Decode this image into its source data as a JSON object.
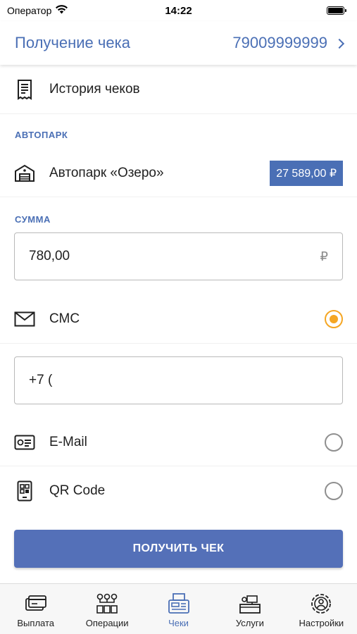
{
  "status_bar": {
    "carrier": "Оператор",
    "time": "14:22"
  },
  "header": {
    "title": "Получение чека",
    "phone": "79009999999"
  },
  "history": {
    "label": "История чеков"
  },
  "fleet_section": {
    "label": "АВТОПАРК",
    "name": "Автопарк «Озеро»",
    "balance": "27 589,00 ₽"
  },
  "amount_section": {
    "label": "СУММА",
    "value": "780,00",
    "currency": "₽"
  },
  "options": {
    "sms": {
      "label": "СМС",
      "phone_value": "+7 ("
    },
    "email": {
      "label": "E-Mail"
    },
    "qr": {
      "label": "QR Code"
    }
  },
  "submit_label": "ПОЛУЧИТЬ ЧЕК",
  "tabs": [
    {
      "label": "Выплата",
      "icon": "payout-icon"
    },
    {
      "label": "Операции",
      "icon": "operations-icon"
    },
    {
      "label": "Чеки",
      "icon": "receipts-icon"
    },
    {
      "label": "Услуги",
      "icon": "services-icon"
    },
    {
      "label": "Настройки",
      "icon": "settings-icon"
    }
  ],
  "colors": {
    "accent": "#4a6fb5",
    "selected_radio": "#f5a623",
    "button": "#5470b8"
  }
}
